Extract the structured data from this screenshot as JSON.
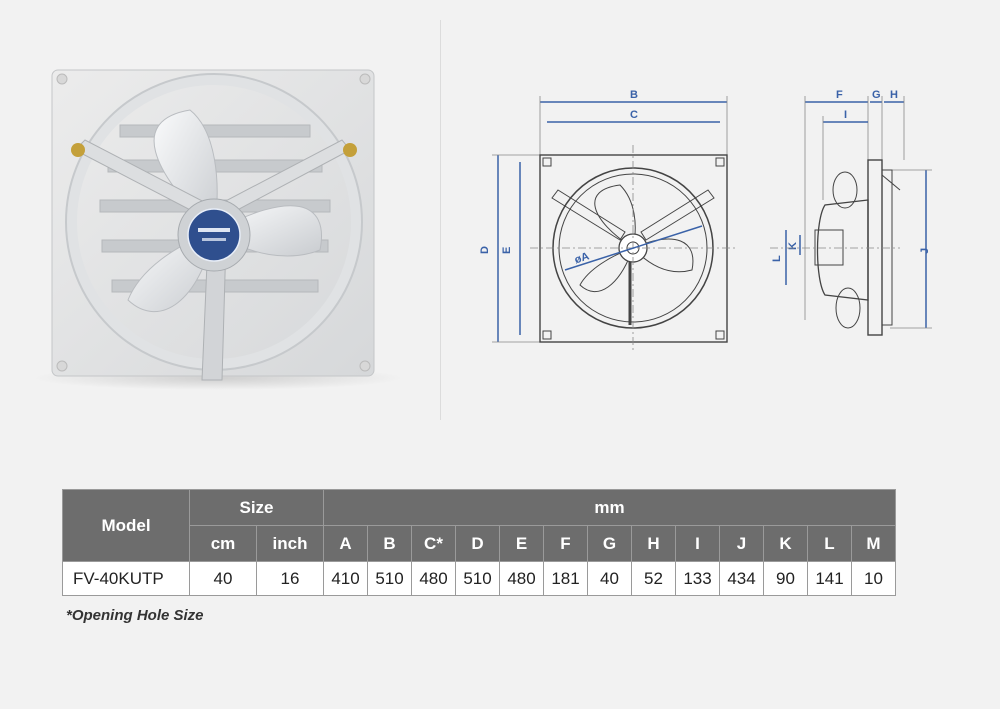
{
  "drawing": {
    "labels": {
      "b": "B",
      "c": "C",
      "d": "D",
      "e": "E",
      "a": "øA",
      "f": "F",
      "g": "G",
      "h": "H",
      "i": "I",
      "j": "J",
      "k": "K",
      "l": "L"
    }
  },
  "table": {
    "header_model": "Model",
    "header_size": "Size",
    "header_mm": "mm",
    "size_columns": [
      "cm",
      "inch"
    ],
    "mm_columns": [
      "A",
      "B",
      "C*",
      "D",
      "E",
      "F",
      "G",
      "H",
      "I",
      "J",
      "K",
      "L",
      "M"
    ],
    "rows": [
      {
        "model": "FV-40KUTP",
        "cm": "40",
        "inch": "16",
        "mm": [
          "410",
          "510",
          "480",
          "510",
          "480",
          "181",
          "40",
          "52",
          "133",
          "434",
          "90",
          "141",
          "10"
        ]
      }
    ]
  },
  "footnote": "*Opening Hole Size",
  "colors": {
    "header_bg": "#6d6d6d",
    "dimension_blue": "#3a62a8"
  }
}
